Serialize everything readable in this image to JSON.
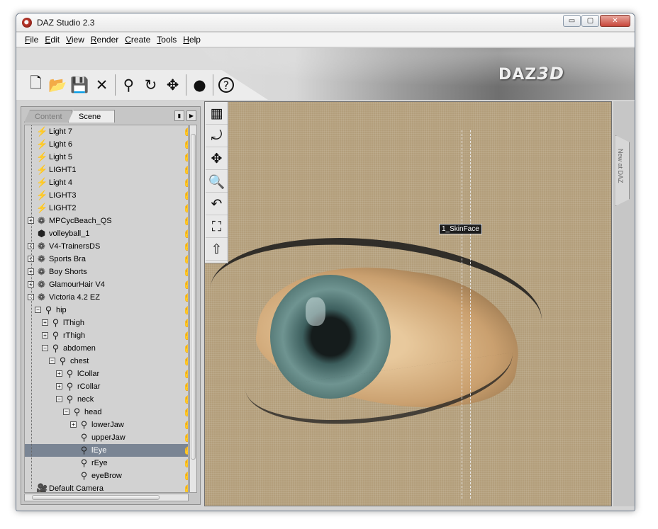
{
  "window": {
    "title": "DAZ Studio 2.3"
  },
  "window_controls": {
    "minimize": "▭",
    "maximize": "▢",
    "close": "✕"
  },
  "menu": [
    "File",
    "Edit",
    "View",
    "Render",
    "Create",
    "Tools",
    "Help"
  ],
  "toolbar": {
    "tools": [
      {
        "name": "new-document-icon",
        "glyph": "🗋"
      },
      {
        "name": "open-folder-icon",
        "glyph": "📂"
      },
      {
        "name": "save-icon",
        "glyph": "💾"
      },
      {
        "name": "delete-icon",
        "glyph": "✕"
      },
      {
        "name": "bone-select-icon",
        "glyph": "⚲"
      },
      {
        "name": "rotate-icon",
        "glyph": "↻"
      },
      {
        "name": "move-icon",
        "glyph": "✥"
      },
      {
        "name": "render-sphere-icon",
        "glyph": "●"
      },
      {
        "name": "help-icon",
        "glyph": "?"
      }
    ],
    "logo_main": "DAZ",
    "logo_sub": "3D"
  },
  "panel": {
    "tabs": [
      "Content",
      "Scene"
    ],
    "active_tab": "Scene",
    "pin_glyph": "▮",
    "menu_glyph": "▶"
  },
  "tree": [
    {
      "label": "Light 7",
      "level": 0,
      "type": "light"
    },
    {
      "label": "Light 6",
      "level": 0,
      "type": "light"
    },
    {
      "label": "Light 5",
      "level": 0,
      "type": "light"
    },
    {
      "label": "LIGHT1",
      "level": 0,
      "type": "light"
    },
    {
      "label": "Light 4",
      "level": 0,
      "type": "light"
    },
    {
      "label": "LIGHT3",
      "level": 0,
      "type": "light"
    },
    {
      "label": "LIGHT2",
      "level": 0,
      "type": "light"
    },
    {
      "label": "MPCycBeach_QS",
      "level": 0,
      "type": "figure",
      "expand": "+"
    },
    {
      "label": "volleyball_1",
      "level": 0,
      "type": "prop"
    },
    {
      "label": "V4-TrainersDS",
      "level": 0,
      "type": "figure",
      "expand": "+"
    },
    {
      "label": "Sports Bra",
      "level": 0,
      "type": "figure",
      "expand": "+"
    },
    {
      "label": "Boy Shorts",
      "level": 0,
      "type": "figure",
      "expand": "+"
    },
    {
      "label": "GlamourHair V4",
      "level": 0,
      "type": "figure",
      "expand": "+"
    },
    {
      "label": "Victoria 4.2 EZ",
      "level": 0,
      "type": "figure",
      "expand": "−"
    },
    {
      "label": "hip",
      "level": 1,
      "type": "bone",
      "expand": "−"
    },
    {
      "label": "lThigh",
      "level": 2,
      "type": "bone",
      "expand": "+"
    },
    {
      "label": "rThigh",
      "level": 2,
      "type": "bone",
      "expand": "+"
    },
    {
      "label": "abdomen",
      "level": 2,
      "type": "bone",
      "expand": "−"
    },
    {
      "label": "chest",
      "level": 3,
      "type": "bone",
      "expand": "−"
    },
    {
      "label": "lCollar",
      "level": 4,
      "type": "bone",
      "expand": "+"
    },
    {
      "label": "rCollar",
      "level": 4,
      "type": "bone",
      "expand": "+"
    },
    {
      "label": "neck",
      "level": 4,
      "type": "bone",
      "expand": "−"
    },
    {
      "label": "head",
      "level": 5,
      "type": "bone",
      "expand": "−"
    },
    {
      "label": "lowerJaw",
      "level": 6,
      "type": "bone",
      "expand": "+"
    },
    {
      "label": "upperJaw",
      "level": 6,
      "type": "bone"
    },
    {
      "label": "lEye",
      "level": 6,
      "type": "bone",
      "selected": true
    },
    {
      "label": "rEye",
      "level": 6,
      "type": "bone"
    },
    {
      "label": "eyeBrow",
      "level": 6,
      "type": "bone"
    },
    {
      "label": "Default Camera",
      "level": 0,
      "type": "camera"
    }
  ],
  "icons": {
    "light": "⚡",
    "figure": "❁",
    "prop": "⬢",
    "bone": "⚲",
    "camera": "🎥",
    "visibility": "✋"
  },
  "viewport": {
    "tools": [
      {
        "name": "viewport-grid-icon",
        "glyph": "▦"
      },
      {
        "name": "orbit-camera-icon",
        "glyph": "⤾"
      },
      {
        "name": "pan-camera-icon",
        "glyph": "✥"
      },
      {
        "name": "zoom-camera-icon",
        "glyph": "🔍"
      },
      {
        "name": "rotate-camera-icon",
        "glyph": "↶"
      },
      {
        "name": "frame-selection-icon",
        "glyph": "⛶"
      },
      {
        "name": "aim-camera-icon",
        "glyph": "⇧"
      }
    ],
    "node_label": "1_SkinFace"
  },
  "side_tab": {
    "label": "New at DAZ"
  },
  "colors": {
    "selection": "#7a8594",
    "viewport_bg": "#b39e7b"
  }
}
